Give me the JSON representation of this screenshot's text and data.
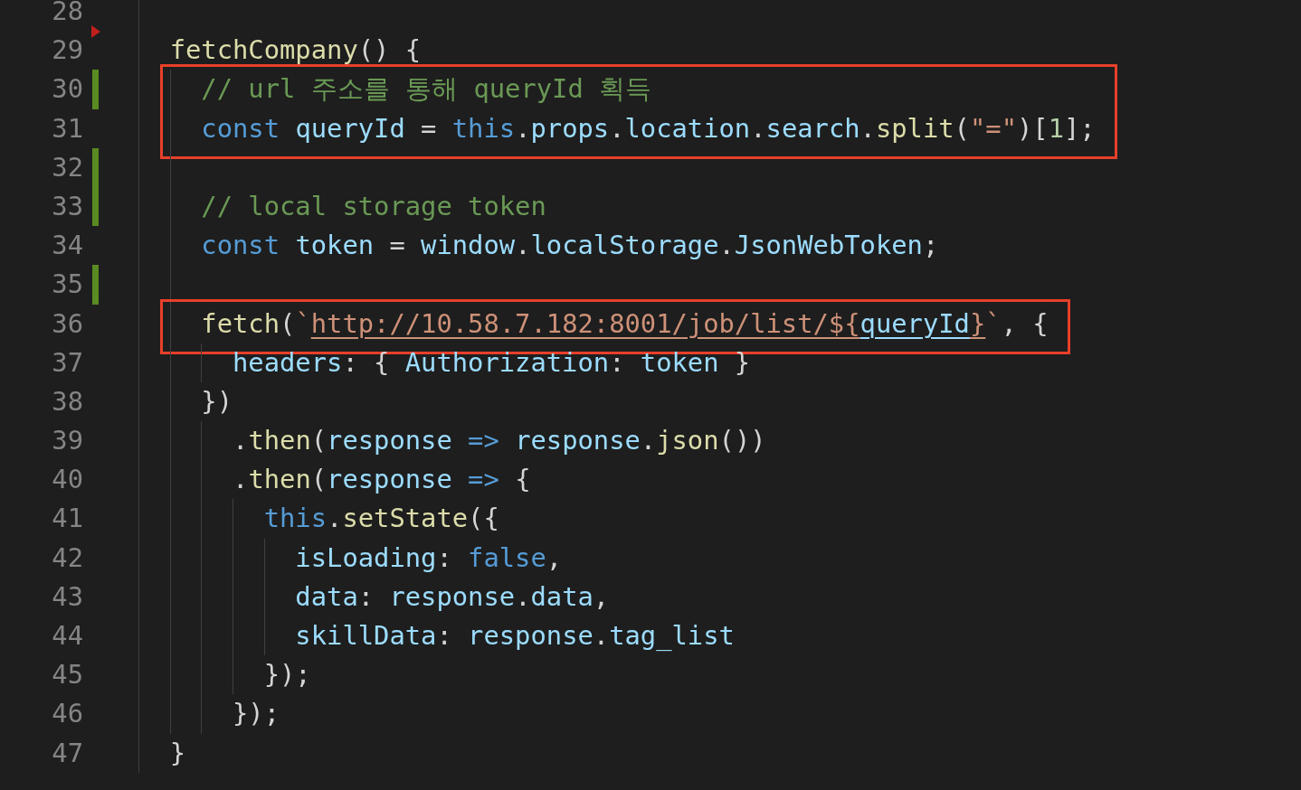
{
  "lines": [
    {
      "number": "28",
      "added": false,
      "deleted": false,
      "boxed": false
    },
    {
      "number": "29",
      "added": false,
      "deleted": true,
      "boxed": false,
      "tokens": [
        {
          "kind": "function",
          "text": "  fetchCompany"
        },
        {
          "kind": "plain",
          "text": "() {"
        }
      ]
    },
    {
      "number": "30",
      "added": true,
      "deleted": false,
      "boxed": true,
      "tokens": [
        {
          "kind": "comment",
          "text": "    // url 주소를 통해 queryId 획득"
        }
      ]
    },
    {
      "number": "31",
      "added": false,
      "deleted": false,
      "boxed": true,
      "tokens": [
        {
          "kind": "keyword",
          "text": "    const"
        },
        {
          "kind": "variable",
          "text": " queryId"
        },
        {
          "kind": "plain",
          "text": " = "
        },
        {
          "kind": "keyword",
          "text": "this"
        },
        {
          "kind": "plain",
          "text": "."
        },
        {
          "kind": "variable",
          "text": "props"
        },
        {
          "kind": "plain",
          "text": "."
        },
        {
          "kind": "variable",
          "text": "location"
        },
        {
          "kind": "plain",
          "text": "."
        },
        {
          "kind": "variable",
          "text": "search"
        },
        {
          "kind": "plain",
          "text": "."
        },
        {
          "kind": "function",
          "text": "split"
        },
        {
          "kind": "plain",
          "text": "("
        },
        {
          "kind": "string",
          "text": "\"=\""
        },
        {
          "kind": "plain",
          "text": ")["
        },
        {
          "kind": "number",
          "text": "1"
        },
        {
          "kind": "plain",
          "text": "];"
        }
      ]
    },
    {
      "number": "32",
      "added": true,
      "deleted": false,
      "boxed": false
    },
    {
      "number": "33",
      "added": true,
      "deleted": false,
      "boxed": false,
      "tokens": [
        {
          "kind": "comment",
          "text": "    // local storage token"
        }
      ]
    },
    {
      "number": "34",
      "added": false,
      "deleted": false,
      "boxed": false,
      "tokens": [
        {
          "kind": "keyword",
          "text": "    const"
        },
        {
          "kind": "variable",
          "text": " token"
        },
        {
          "kind": "plain",
          "text": " = "
        },
        {
          "kind": "variable",
          "text": "window"
        },
        {
          "kind": "plain",
          "text": "."
        },
        {
          "kind": "variable",
          "text": "localStorage"
        },
        {
          "kind": "plain",
          "text": "."
        },
        {
          "kind": "variable",
          "text": "JsonWebToken"
        },
        {
          "kind": "plain",
          "text": ";"
        }
      ]
    },
    {
      "number": "35",
      "added": true,
      "deleted": false,
      "boxed": false
    },
    {
      "number": "36",
      "added": false,
      "deleted": false,
      "boxed": true,
      "tokens": [
        {
          "kind": "function",
          "text": "    fetch"
        },
        {
          "kind": "plain",
          "text": "("
        },
        {
          "kind": "string",
          "text": "`"
        },
        {
          "kind": "link-string",
          "text": "http://10.58.7.182:8001/job/list/${"
        },
        {
          "kind": "link-variable",
          "text": "queryId"
        },
        {
          "kind": "link-string",
          "text": "}"
        },
        {
          "kind": "string",
          "text": "`"
        },
        {
          "kind": "plain",
          "text": ", {"
        }
      ]
    },
    {
      "number": "37",
      "added": false,
      "deleted": false,
      "boxed": false,
      "tokens": [
        {
          "kind": "variable",
          "text": "      headers"
        },
        {
          "kind": "plain",
          "text": ": { "
        },
        {
          "kind": "variable",
          "text": "Authorization"
        },
        {
          "kind": "plain",
          "text": ": "
        },
        {
          "kind": "variable",
          "text": "token"
        },
        {
          "kind": "plain",
          "text": " }"
        }
      ]
    },
    {
      "number": "38",
      "added": false,
      "deleted": false,
      "boxed": false,
      "tokens": [
        {
          "kind": "plain",
          "text": "    })"
        }
      ]
    },
    {
      "number": "39",
      "added": false,
      "deleted": false,
      "boxed": false,
      "tokens": [
        {
          "kind": "plain",
          "text": "      ."
        },
        {
          "kind": "function",
          "text": "then"
        },
        {
          "kind": "plain",
          "text": "("
        },
        {
          "kind": "variable",
          "text": "response"
        },
        {
          "kind": "keyword",
          "text": " => "
        },
        {
          "kind": "variable",
          "text": "response"
        },
        {
          "kind": "plain",
          "text": "."
        },
        {
          "kind": "function",
          "text": "json"
        },
        {
          "kind": "plain",
          "text": "())"
        }
      ]
    },
    {
      "number": "40",
      "added": false,
      "deleted": false,
      "boxed": false,
      "tokens": [
        {
          "kind": "plain",
          "text": "      ."
        },
        {
          "kind": "function",
          "text": "then"
        },
        {
          "kind": "plain",
          "text": "("
        },
        {
          "kind": "variable",
          "text": "response"
        },
        {
          "kind": "keyword",
          "text": " =>"
        },
        {
          "kind": "plain",
          "text": " {"
        }
      ]
    },
    {
      "number": "41",
      "added": false,
      "deleted": false,
      "boxed": false,
      "tokens": [
        {
          "kind": "keyword",
          "text": "        this"
        },
        {
          "kind": "plain",
          "text": "."
        },
        {
          "kind": "function",
          "text": "setState"
        },
        {
          "kind": "plain",
          "text": "({"
        }
      ]
    },
    {
      "number": "42",
      "added": false,
      "deleted": false,
      "boxed": false,
      "tokens": [
        {
          "kind": "variable",
          "text": "          isLoading"
        },
        {
          "kind": "plain",
          "text": ": "
        },
        {
          "kind": "keyword",
          "text": "false"
        },
        {
          "kind": "plain",
          "text": ","
        }
      ]
    },
    {
      "number": "43",
      "added": false,
      "deleted": false,
      "boxed": false,
      "tokens": [
        {
          "kind": "variable",
          "text": "          data"
        },
        {
          "kind": "plain",
          "text": ": "
        },
        {
          "kind": "variable",
          "text": "response"
        },
        {
          "kind": "plain",
          "text": "."
        },
        {
          "kind": "variable",
          "text": "data"
        },
        {
          "kind": "plain",
          "text": ","
        }
      ]
    },
    {
      "number": "44",
      "added": false,
      "deleted": false,
      "boxed": false,
      "tokens": [
        {
          "kind": "variable",
          "text": "          skillData"
        },
        {
          "kind": "plain",
          "text": ": "
        },
        {
          "kind": "variable",
          "text": "response"
        },
        {
          "kind": "plain",
          "text": "."
        },
        {
          "kind": "variable",
          "text": "tag_list"
        }
      ]
    },
    {
      "number": "45",
      "added": false,
      "deleted": false,
      "boxed": false,
      "tokens": [
        {
          "kind": "plain",
          "text": "        });"
        }
      ]
    },
    {
      "number": "46",
      "added": false,
      "deleted": false,
      "boxed": false,
      "tokens": [
        {
          "kind": "plain",
          "text": "      });"
        }
      ]
    },
    {
      "number": "47",
      "added": false,
      "deleted": false,
      "boxed": false,
      "tokens": [
        {
          "kind": "plain",
          "text": "  }"
        }
      ]
    }
  ]
}
